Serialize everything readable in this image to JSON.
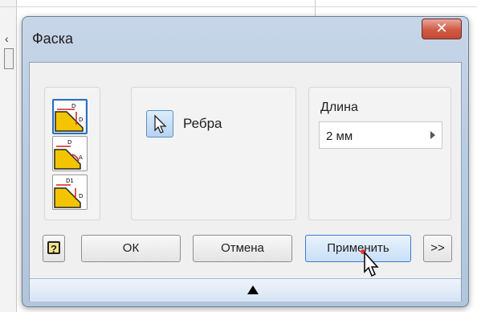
{
  "background": {
    "left_glyph": "‹"
  },
  "dialog": {
    "title": "Фаска",
    "close_icon": "close-x-icon",
    "modes": [
      {
        "name": "distance-mode",
        "icon": "chamfer-distance-icon",
        "active": true
      },
      {
        "name": "distance-angle-mode",
        "icon": "chamfer-distance-angle-icon",
        "active": false
      },
      {
        "name": "two-distances-mode",
        "icon": "chamfer-two-distances-icon",
        "active": false
      }
    ],
    "edges": {
      "button_icon": "cursor-arrow-icon",
      "label": "Ребра"
    },
    "length": {
      "label": "Длина",
      "value": "2 мм"
    },
    "buttons": {
      "help_glyph": "?",
      "ok": "ОК",
      "cancel": "Отмена",
      "apply": "Применить",
      "more": ">>"
    }
  }
}
